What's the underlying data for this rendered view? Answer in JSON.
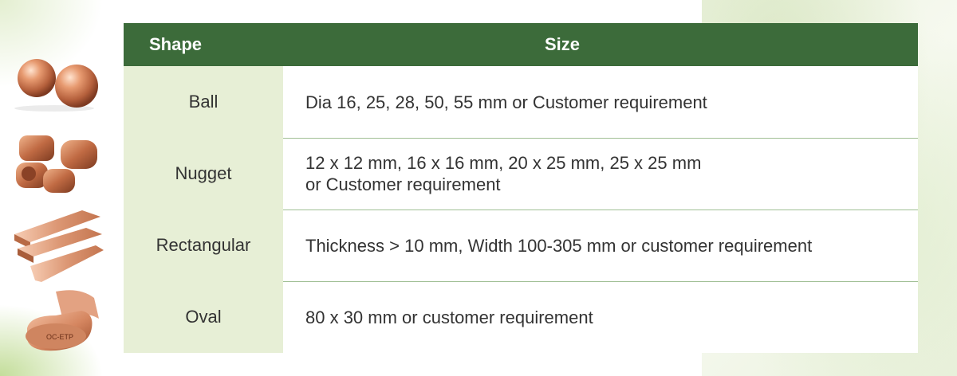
{
  "table": {
    "headers": {
      "shape": "Shape",
      "size": "Size"
    },
    "rows": [
      {
        "shape": "Ball",
        "size": [
          "Dia 16, 25, 28, 50, 55 mm or Customer requirement"
        ]
      },
      {
        "shape": "Nugget",
        "size": [
          "12 x 12 mm, 16 x 16 mm, 20 x 25 mm, 25 x 25 mm",
          "or Customer requirement"
        ]
      },
      {
        "shape": "Rectangular",
        "size": [
          "Thickness > 10 mm, Width 100-305 mm or customer requirement"
        ]
      },
      {
        "shape": "Oval",
        "size": [
          "80 x 30 mm or customer requirement"
        ]
      }
    ]
  },
  "images": {
    "ball": "copper-balls",
    "nugget": "copper-nuggets",
    "rectangular": "copper-rectangular-bars",
    "oval": "copper-oval-anode",
    "oval_stamp": "OC-ETP"
  },
  "colors": {
    "header_bg": "#3c6b3a",
    "shape_cell_bg": "#e7efd6",
    "copper": "#c9784f"
  }
}
